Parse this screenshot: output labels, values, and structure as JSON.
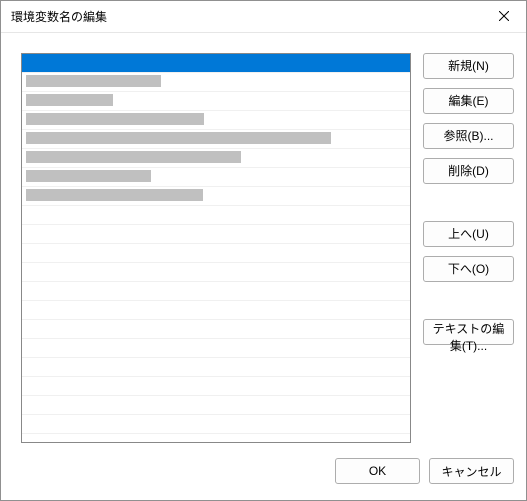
{
  "dialog": {
    "title": "環境変数名の編集"
  },
  "list": {
    "items": [
      {
        "value": "",
        "selected": true,
        "redact_width": 378
      },
      {
        "value": "",
        "selected": false,
        "redact_width": 135
      },
      {
        "value": "",
        "selected": false,
        "redact_width": 87
      },
      {
        "value": "",
        "selected": false,
        "redact_width": 178
      },
      {
        "value": "",
        "selected": false,
        "redact_width": 305
      },
      {
        "value": "",
        "selected": false,
        "redact_width": 215
      },
      {
        "value": "",
        "selected": false,
        "redact_width": 125
      },
      {
        "value": "",
        "selected": false,
        "redact_width": 177
      }
    ],
    "visible_rows": 20
  },
  "buttons": {
    "new": "新規(N)",
    "edit": "編集(E)",
    "browse": "参照(B)...",
    "delete": "削除(D)",
    "up": "上へ(U)",
    "down": "下へ(O)",
    "edit_text": "テキストの編集(T)..."
  },
  "footer": {
    "ok": "OK",
    "cancel": "キャンセル"
  }
}
